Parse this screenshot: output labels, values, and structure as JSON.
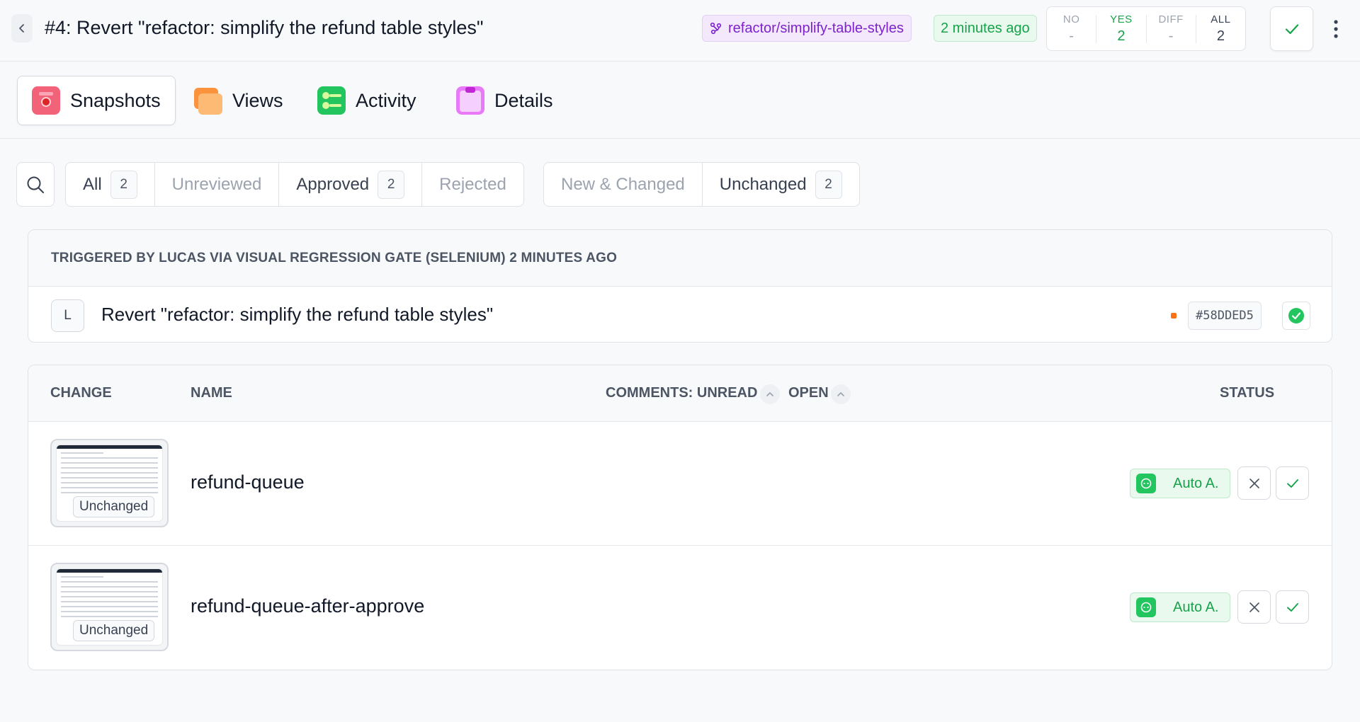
{
  "header": {
    "title": "#4: Revert \"refactor: simplify the refund table styles\"",
    "branch": "refactor/simplify-table-styles",
    "time_ago": "2 minutes ago",
    "stats": [
      {
        "label": "NO",
        "value": "-"
      },
      {
        "label": "YES",
        "value": "2"
      },
      {
        "label": "DIFF",
        "value": "-"
      },
      {
        "label": "ALL",
        "value": "2"
      }
    ]
  },
  "tabs": [
    {
      "label": "Snapshots",
      "active": true,
      "icon": "camera-icon"
    },
    {
      "label": "Views",
      "active": false,
      "icon": "views-icon"
    },
    {
      "label": "Activity",
      "active": false,
      "icon": "activity-icon"
    },
    {
      "label": "Details",
      "active": false,
      "icon": "clipboard-icon"
    }
  ],
  "filters": {
    "review": [
      {
        "label": "All",
        "count": "2"
      },
      {
        "label": "Unreviewed",
        "count": null
      },
      {
        "label": "Approved",
        "count": "2"
      },
      {
        "label": "Rejected",
        "count": null
      }
    ],
    "change": [
      {
        "label": "New & Changed",
        "count": null
      },
      {
        "label": "Unchanged",
        "count": "2"
      }
    ]
  },
  "build": {
    "triggered_by": "TRIGGERED BY LUCAS VIA VISUAL REGRESSION GATE (SELENIUM) 2 MINUTES AGO",
    "avatar_initial": "L",
    "commit_message": "Revert \"refactor: simplify the refund table styles\"",
    "commit_hash": "#58DDED5"
  },
  "table": {
    "headers": {
      "change": "CHANGE",
      "name": "NAME",
      "comments_unread": "COMMENTS: UNREAD",
      "open": "OPEN",
      "status": "STATUS"
    },
    "rows": [
      {
        "change_label": "Unchanged",
        "name": "refund-queue",
        "status": "Auto A."
      },
      {
        "change_label": "Unchanged",
        "name": "refund-queue-after-approve",
        "status": "Auto A."
      }
    ]
  },
  "colors": {
    "accent_green": "#16a34a",
    "branch_purple": "#7e22ce",
    "hash_dot_orange": "#f97316"
  }
}
